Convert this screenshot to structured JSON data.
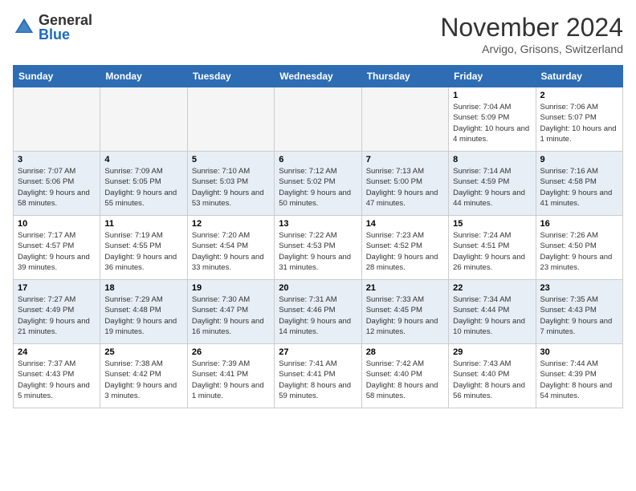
{
  "logo": {
    "general": "General",
    "blue": "Blue"
  },
  "title": "November 2024",
  "location": "Arvigo, Grisons, Switzerland",
  "days_header": [
    "Sunday",
    "Monday",
    "Tuesday",
    "Wednesday",
    "Thursday",
    "Friday",
    "Saturday"
  ],
  "weeks": [
    {
      "days": [
        {
          "num": "",
          "empty": true
        },
        {
          "num": "",
          "empty": true
        },
        {
          "num": "",
          "empty": true
        },
        {
          "num": "",
          "empty": true
        },
        {
          "num": "",
          "empty": true
        },
        {
          "num": "1",
          "sunrise": "Sunrise: 7:04 AM",
          "sunset": "Sunset: 5:09 PM",
          "daylight": "Daylight: 10 hours and 4 minutes."
        },
        {
          "num": "2",
          "sunrise": "Sunrise: 7:06 AM",
          "sunset": "Sunset: 5:07 PM",
          "daylight": "Daylight: 10 hours and 1 minute."
        }
      ]
    },
    {
      "days": [
        {
          "num": "3",
          "sunrise": "Sunrise: 7:07 AM",
          "sunset": "Sunset: 5:06 PM",
          "daylight": "Daylight: 9 hours and 58 minutes."
        },
        {
          "num": "4",
          "sunrise": "Sunrise: 7:09 AM",
          "sunset": "Sunset: 5:05 PM",
          "daylight": "Daylight: 9 hours and 55 minutes."
        },
        {
          "num": "5",
          "sunrise": "Sunrise: 7:10 AM",
          "sunset": "Sunset: 5:03 PM",
          "daylight": "Daylight: 9 hours and 53 minutes."
        },
        {
          "num": "6",
          "sunrise": "Sunrise: 7:12 AM",
          "sunset": "Sunset: 5:02 PM",
          "daylight": "Daylight: 9 hours and 50 minutes."
        },
        {
          "num": "7",
          "sunrise": "Sunrise: 7:13 AM",
          "sunset": "Sunset: 5:00 PM",
          "daylight": "Daylight: 9 hours and 47 minutes."
        },
        {
          "num": "8",
          "sunrise": "Sunrise: 7:14 AM",
          "sunset": "Sunset: 4:59 PM",
          "daylight": "Daylight: 9 hours and 44 minutes."
        },
        {
          "num": "9",
          "sunrise": "Sunrise: 7:16 AM",
          "sunset": "Sunset: 4:58 PM",
          "daylight": "Daylight: 9 hours and 41 minutes."
        }
      ]
    },
    {
      "days": [
        {
          "num": "10",
          "sunrise": "Sunrise: 7:17 AM",
          "sunset": "Sunset: 4:57 PM",
          "daylight": "Daylight: 9 hours and 39 minutes."
        },
        {
          "num": "11",
          "sunrise": "Sunrise: 7:19 AM",
          "sunset": "Sunset: 4:55 PM",
          "daylight": "Daylight: 9 hours and 36 minutes."
        },
        {
          "num": "12",
          "sunrise": "Sunrise: 7:20 AM",
          "sunset": "Sunset: 4:54 PM",
          "daylight": "Daylight: 9 hours and 33 minutes."
        },
        {
          "num": "13",
          "sunrise": "Sunrise: 7:22 AM",
          "sunset": "Sunset: 4:53 PM",
          "daylight": "Daylight: 9 hours and 31 minutes."
        },
        {
          "num": "14",
          "sunrise": "Sunrise: 7:23 AM",
          "sunset": "Sunset: 4:52 PM",
          "daylight": "Daylight: 9 hours and 28 minutes."
        },
        {
          "num": "15",
          "sunrise": "Sunrise: 7:24 AM",
          "sunset": "Sunset: 4:51 PM",
          "daylight": "Daylight: 9 hours and 26 minutes."
        },
        {
          "num": "16",
          "sunrise": "Sunrise: 7:26 AM",
          "sunset": "Sunset: 4:50 PM",
          "daylight": "Daylight: 9 hours and 23 minutes."
        }
      ]
    },
    {
      "days": [
        {
          "num": "17",
          "sunrise": "Sunrise: 7:27 AM",
          "sunset": "Sunset: 4:49 PM",
          "daylight": "Daylight: 9 hours and 21 minutes."
        },
        {
          "num": "18",
          "sunrise": "Sunrise: 7:29 AM",
          "sunset": "Sunset: 4:48 PM",
          "daylight": "Daylight: 9 hours and 19 minutes."
        },
        {
          "num": "19",
          "sunrise": "Sunrise: 7:30 AM",
          "sunset": "Sunset: 4:47 PM",
          "daylight": "Daylight: 9 hours and 16 minutes."
        },
        {
          "num": "20",
          "sunrise": "Sunrise: 7:31 AM",
          "sunset": "Sunset: 4:46 PM",
          "daylight": "Daylight: 9 hours and 14 minutes."
        },
        {
          "num": "21",
          "sunrise": "Sunrise: 7:33 AM",
          "sunset": "Sunset: 4:45 PM",
          "daylight": "Daylight: 9 hours and 12 minutes."
        },
        {
          "num": "22",
          "sunrise": "Sunrise: 7:34 AM",
          "sunset": "Sunset: 4:44 PM",
          "daylight": "Daylight: 9 hours and 10 minutes."
        },
        {
          "num": "23",
          "sunrise": "Sunrise: 7:35 AM",
          "sunset": "Sunset: 4:43 PM",
          "daylight": "Daylight: 9 hours and 7 minutes."
        }
      ]
    },
    {
      "days": [
        {
          "num": "24",
          "sunrise": "Sunrise: 7:37 AM",
          "sunset": "Sunset: 4:43 PM",
          "daylight": "Daylight: 9 hours and 5 minutes."
        },
        {
          "num": "25",
          "sunrise": "Sunrise: 7:38 AM",
          "sunset": "Sunset: 4:42 PM",
          "daylight": "Daylight: 9 hours and 3 minutes."
        },
        {
          "num": "26",
          "sunrise": "Sunrise: 7:39 AM",
          "sunset": "Sunset: 4:41 PM",
          "daylight": "Daylight: 9 hours and 1 minute."
        },
        {
          "num": "27",
          "sunrise": "Sunrise: 7:41 AM",
          "sunset": "Sunset: 4:41 PM",
          "daylight": "Daylight: 8 hours and 59 minutes."
        },
        {
          "num": "28",
          "sunrise": "Sunrise: 7:42 AM",
          "sunset": "Sunset: 4:40 PM",
          "daylight": "Daylight: 8 hours and 58 minutes."
        },
        {
          "num": "29",
          "sunrise": "Sunrise: 7:43 AM",
          "sunset": "Sunset: 4:40 PM",
          "daylight": "Daylight: 8 hours and 56 minutes."
        },
        {
          "num": "30",
          "sunrise": "Sunrise: 7:44 AM",
          "sunset": "Sunset: 4:39 PM",
          "daylight": "Daylight: 8 hours and 54 minutes."
        }
      ]
    }
  ]
}
